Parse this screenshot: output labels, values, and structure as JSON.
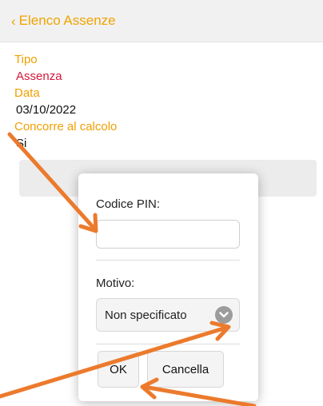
{
  "navbar": {
    "back_label": "Elenco Assenze",
    "back_icon": "chevron-left-icon",
    "accent_color": "#f0a400"
  },
  "details": {
    "fields": [
      {
        "label": "Tipo",
        "value": "Assenza"
      },
      {
        "label": "Data",
        "value": "03/10/2022"
      },
      {
        "label": "Concorre al calcolo",
        "value": "Si"
      }
    ],
    "value_highlight_color": "#d4183d"
  },
  "dialog": {
    "pin_label": "Codice PIN:",
    "pin_value": "",
    "reason_label": "Motivo:",
    "reason_selected": "Non specificato",
    "reason_icon": "chevron-down-circle-icon",
    "ok_label": "OK",
    "cancel_label": "Cancella"
  },
  "annotations": {
    "arrow_color": "#ec7a2c",
    "arrow_count": 3
  }
}
